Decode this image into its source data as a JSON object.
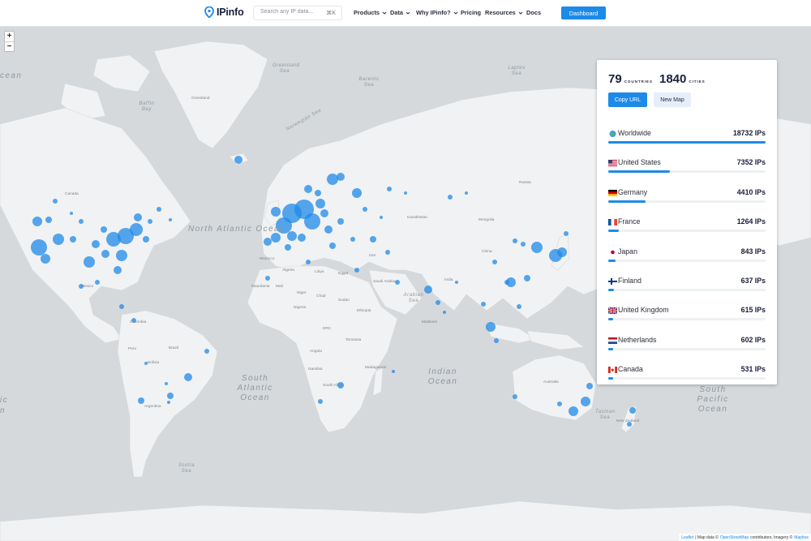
{
  "header": {
    "logo_text": "IPinfo",
    "search_placeholder": "Search any IP data...",
    "search_shortcut": "⌘K",
    "nav": [
      {
        "label": "Products",
        "dropdown": true
      },
      {
        "label": "Data",
        "dropdown": true
      },
      {
        "label": "Why IPinfo?",
        "dropdown": true
      },
      {
        "label": "Pricing",
        "dropdown": false
      },
      {
        "label": "Resources",
        "dropdown": true
      },
      {
        "label": "Docs",
        "dropdown": false
      }
    ],
    "dashboard_label": "Dashboard",
    "accent_color": "#1d8ae8"
  },
  "map": {
    "zoom_in": "+",
    "zoom_out": "−",
    "oceans": {
      "north_atlantic": "North Atlantic Ocean",
      "south_atlantic": "South Atlantic Ocean",
      "indian": "Indian Ocean",
      "south_pacific": "South Pacific Ocean",
      "arctic_left": "cean",
      "pacific_left": "ic",
      "pacific_left2": "n"
    },
    "seas": {
      "greenland": "Greenland Sea",
      "barents": "Barents Sea",
      "laptev": "Laptev Sea",
      "norwegian": "Norwegian Sea",
      "baffin": "Baffin Bay",
      "arabian": "Arabian Sea",
      "tasman": "Tasman Sea",
      "scotia": "Scotia Sea"
    },
    "countries": {
      "greenland": "Greenland",
      "canada": "Canada",
      "kazakhstan": "Kazakhstan",
      "mongolia": "Mongolia",
      "china": "China",
      "india": "India",
      "algeria": "Algeria",
      "libya": "Libya",
      "egypt": "Egypt",
      "mali": "Mali",
      "niger": "Niger",
      "chad": "Chad",
      "sudan": "Sudan",
      "ethiopia": "Ethiopia",
      "nigeria": "Nigeria",
      "drc": "DRC",
      "tanzania": "Tanzania",
      "angola": "Angola",
      "namibia": "Namibia",
      "south_africa": "South Africa",
      "madagascar": "Madagascar",
      "morocco": "Morocco",
      "mauritania": "Mauritania",
      "iran": "Iran",
      "saudi_arabia": "Saudi Arabia",
      "peru": "Peru",
      "bolivia": "Bolivia",
      "brazil": "Brazil",
      "colombia": "Colombia",
      "argentina": "Argentina",
      "australia": "Australia",
      "mexico": "Mexico",
      "new_zealand": "New Zealand",
      "maldives": "Maldives",
      "russia": "Russia"
    },
    "attribution": {
      "leaflet": "Leaflet",
      "sep1": "| Map data ©",
      "osm": "OpenStreetMap",
      "contributors": "contributors, Imagery ©",
      "mapbox": "Mapbox"
    },
    "dot_color": "#1d8ae8"
  },
  "panel": {
    "countries_count": "79",
    "countries_label": "COUNTRIES",
    "cities_count": "1840",
    "cities_label": "CITIES",
    "copy_url_label": "Copy URL",
    "new_map_label": "New Map",
    "rows": [
      {
        "name": "Worldwide",
        "count": "18732 IPs",
        "fraction": 1.0,
        "flag": "globe"
      },
      {
        "name": "United States",
        "count": "7352 IPs",
        "fraction": 0.3925,
        "flag": "us"
      },
      {
        "name": "Germany",
        "count": "4410 IPs",
        "fraction": 0.2354,
        "flag": "de"
      },
      {
        "name": "France",
        "count": "1264 IPs",
        "fraction": 0.0675,
        "flag": "fr"
      },
      {
        "name": "Japan",
        "count": "843 IPs",
        "fraction": 0.045,
        "flag": "jp"
      },
      {
        "name": "Finland",
        "count": "637 IPs",
        "fraction": 0.034,
        "flag": "fi"
      },
      {
        "name": "United Kingdom",
        "count": "615 IPs",
        "fraction": 0.0328,
        "flag": "gb"
      },
      {
        "name": "Netherlands",
        "count": "602 IPs",
        "fraction": 0.0321,
        "flag": "nl"
      },
      {
        "name": "Canada",
        "count": "531 IPs",
        "fraction": 0.0283,
        "flag": "ca"
      }
    ]
  }
}
